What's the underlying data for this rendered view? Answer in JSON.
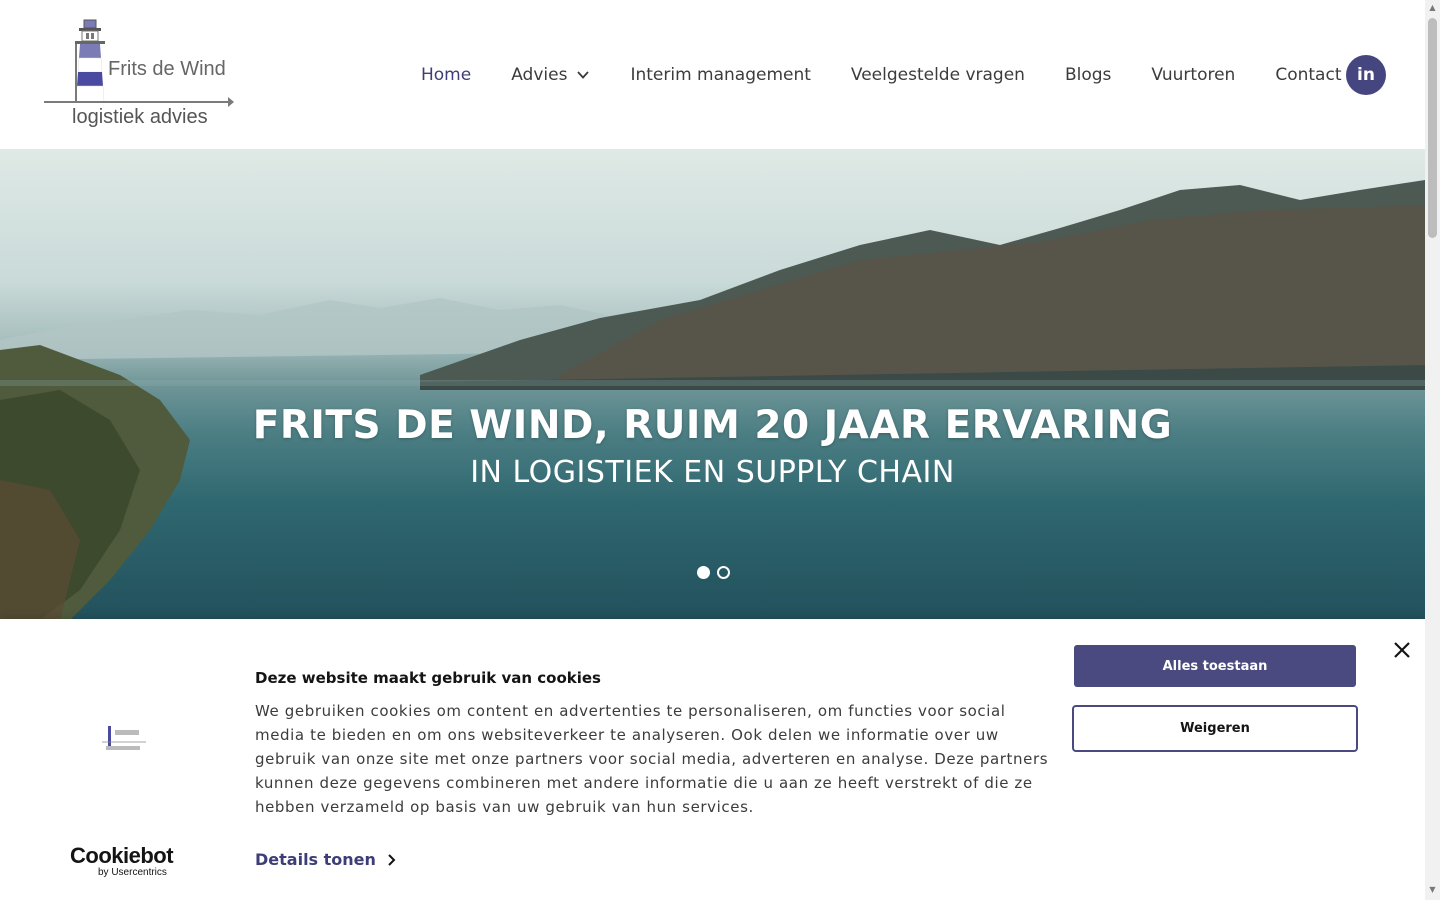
{
  "logo": {
    "line1": "Frits de Wind",
    "line2": "logistiek advies"
  },
  "nav": {
    "items": [
      {
        "label": "Home",
        "active": true
      },
      {
        "label": "Advies",
        "dropdown": true
      },
      {
        "label": "Interim management"
      },
      {
        "label": "Veelgestelde vragen"
      },
      {
        "label": "Blogs"
      },
      {
        "label": "Vuurtoren"
      },
      {
        "label": "Contact"
      }
    ],
    "linkedin_label": "in"
  },
  "hero": {
    "title": "FRITS DE WIND, RUIM 20 JAAR ERVARING",
    "subtitle": "IN LOGISTIEK EN SUPPLY CHAIN",
    "slides": 2,
    "active_slide": 1
  },
  "cookie": {
    "title": "Deze website maakt gebruik van cookies",
    "body": "We gebruiken cookies om content en advertenties te personaliseren, om functies voor social media te bieden en om ons websiteverkeer te analyseren. Ook delen we informatie over uw gebruik van onze site met onze partners voor social media, adverteren en analyse. Deze partners kunnen deze gegevens combineren met andere informatie die u aan ze heeft verstrekt of die ze hebben verzameld op basis van uw gebruik van hun services.",
    "details_label": "Details tonen",
    "allow_label": "Alles toestaan",
    "deny_label": "Weigeren",
    "brand_name": "Cookiebot",
    "brand_by": "by Usercentrics"
  },
  "colors": {
    "accent": "#45457f",
    "text": "#3c3c3c"
  }
}
